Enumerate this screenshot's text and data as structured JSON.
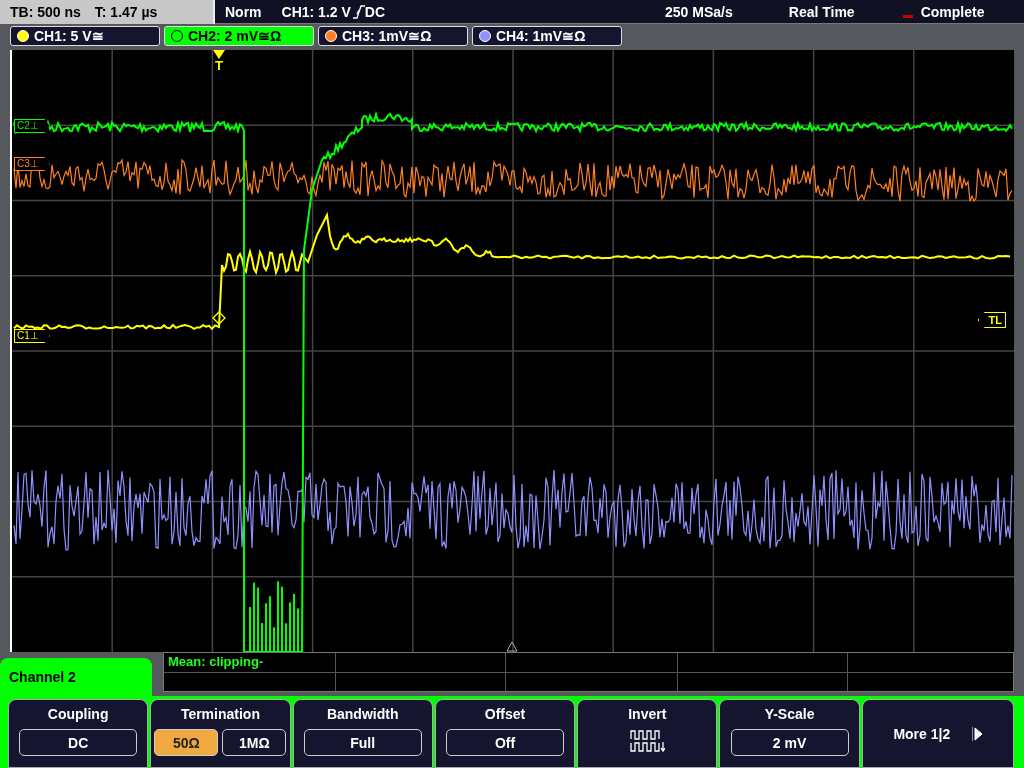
{
  "status_bar": {
    "timebase": "TB: 500 ns",
    "trigger_time": "T: 1.47 µs",
    "mode": "Norm",
    "trigger_source": "CH1: 1.2 V",
    "trigger_coupling": "DC",
    "sample_rate": "250 MSa/s",
    "acquisition": "Real Time",
    "state": "Complete"
  },
  "channels": [
    {
      "label": "CH1: 5 V≅",
      "selected": false,
      "color": "#ffff00"
    },
    {
      "label": "CH2: 2 mV≅Ω",
      "selected": true,
      "color": "#00ff00"
    },
    {
      "label": "CH3: 1mV≅Ω",
      "selected": false,
      "color": "#ff8020"
    },
    {
      "label": "CH4: 1mV≅Ω",
      "selected": false,
      "color": "#9090ff"
    }
  ],
  "markers": [
    {
      "label": "C2⊥",
      "color": "#00ff00"
    },
    {
      "label": "C3⊥",
      "color": "#ff8020"
    },
    {
      "label": "C1⊥",
      "color": "#ffff00"
    }
  ],
  "trigger": {
    "label": "T",
    "level_label": "TL"
  },
  "menu_title": "Channel 2",
  "measurement": "Mean: clipping-",
  "softkeys": [
    {
      "kind": "value",
      "title": "Coupling",
      "value": "DC"
    },
    {
      "kind": "options",
      "title": "Termination",
      "options": [
        {
          "label": "50Ω",
          "selected": true
        },
        {
          "label": "1MΩ",
          "selected": false
        }
      ]
    },
    {
      "kind": "value",
      "title": "Bandwidth",
      "value": "Full"
    },
    {
      "kind": "value",
      "title": "Offset",
      "value": "Off"
    },
    {
      "kind": "icon",
      "title": "Invert"
    },
    {
      "kind": "value",
      "title": "Y-Scale",
      "value": "2 mV"
    },
    {
      "kind": "more",
      "title": "More 1|2"
    }
  ]
}
